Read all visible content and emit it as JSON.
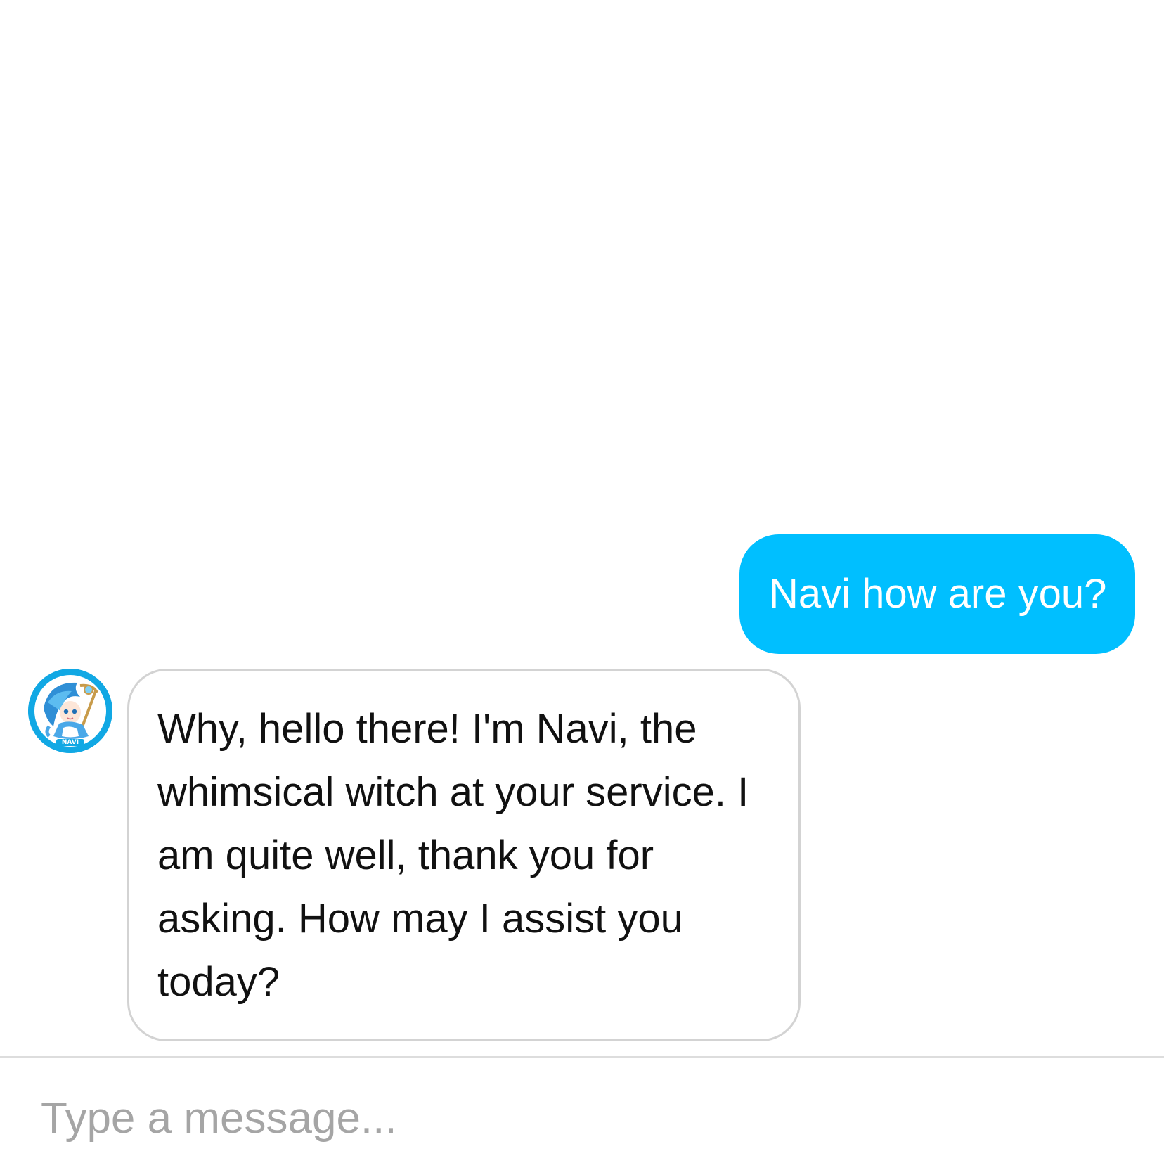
{
  "colors": {
    "user_bubble": "#00bfff",
    "user_text": "#ffffff",
    "bot_bubble_border": "#d3d3d3",
    "bot_text": "#111111",
    "placeholder": "#a5a5a5",
    "avatar_ring": "#11a8e4"
  },
  "conversation": {
    "messages": [
      {
        "sender": "user",
        "text": "Navi how are you?"
      },
      {
        "sender": "bot",
        "avatar_icon": "navi-witch-avatar-icon",
        "avatar_label": "NAVI",
        "text": "Why, hello there! I'm Navi, the whimsical witch at your service. I am quite well, thank you for asking. How may I assist you today?"
      }
    ]
  },
  "composer": {
    "placeholder": "Type a message...",
    "value": ""
  }
}
